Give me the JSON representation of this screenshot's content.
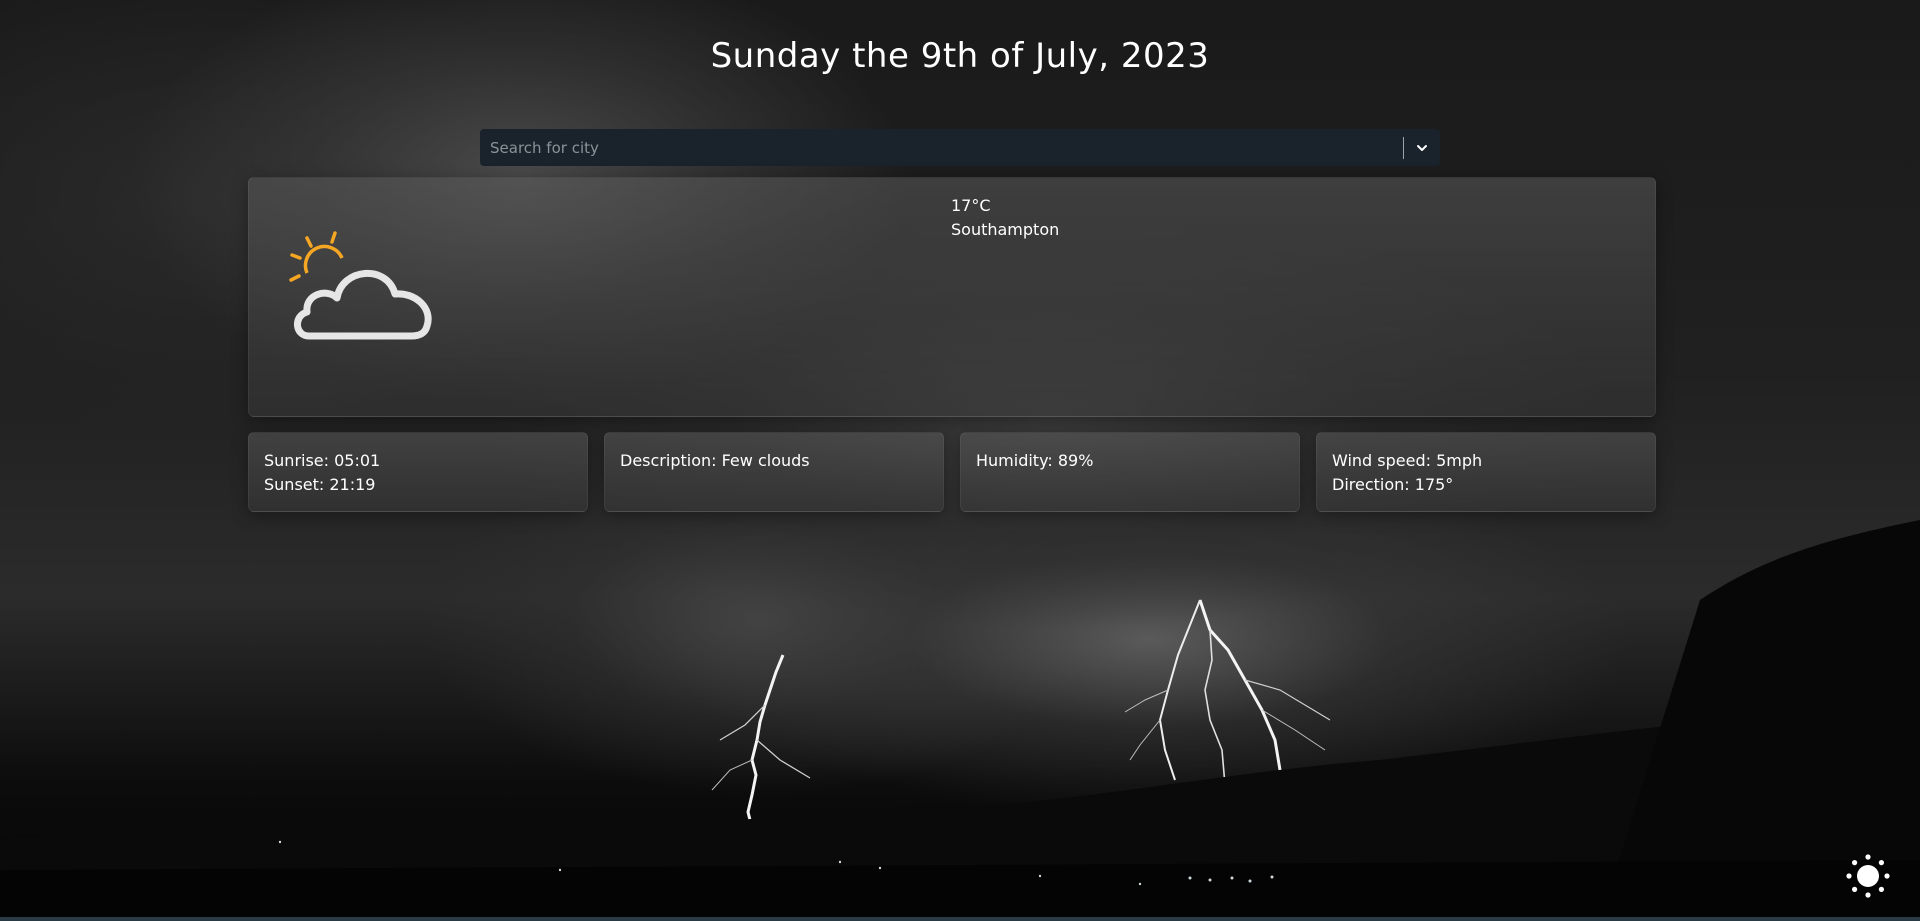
{
  "header": {
    "date": "Sunday the 9th of July, 2023"
  },
  "search": {
    "placeholder": "Search for city"
  },
  "current": {
    "icon": "partly-cloudy-icon",
    "temperature": "17°C",
    "city": "Southampton"
  },
  "stats": {
    "sunrise": "Sunrise: 05:01",
    "sunset": "Sunset: 21:19",
    "description": "Description: Few clouds",
    "humidity": "Humidity: 89%",
    "wind_speed": "Wind speed: 5mph",
    "wind_direction": "Direction: 175°"
  },
  "theme_toggle": {
    "icon": "sun-icon"
  },
  "colors": {
    "sun_accent": "#f5a623",
    "cloud_outline": "#e6e6e6",
    "search_bg": "#1a232b"
  }
}
